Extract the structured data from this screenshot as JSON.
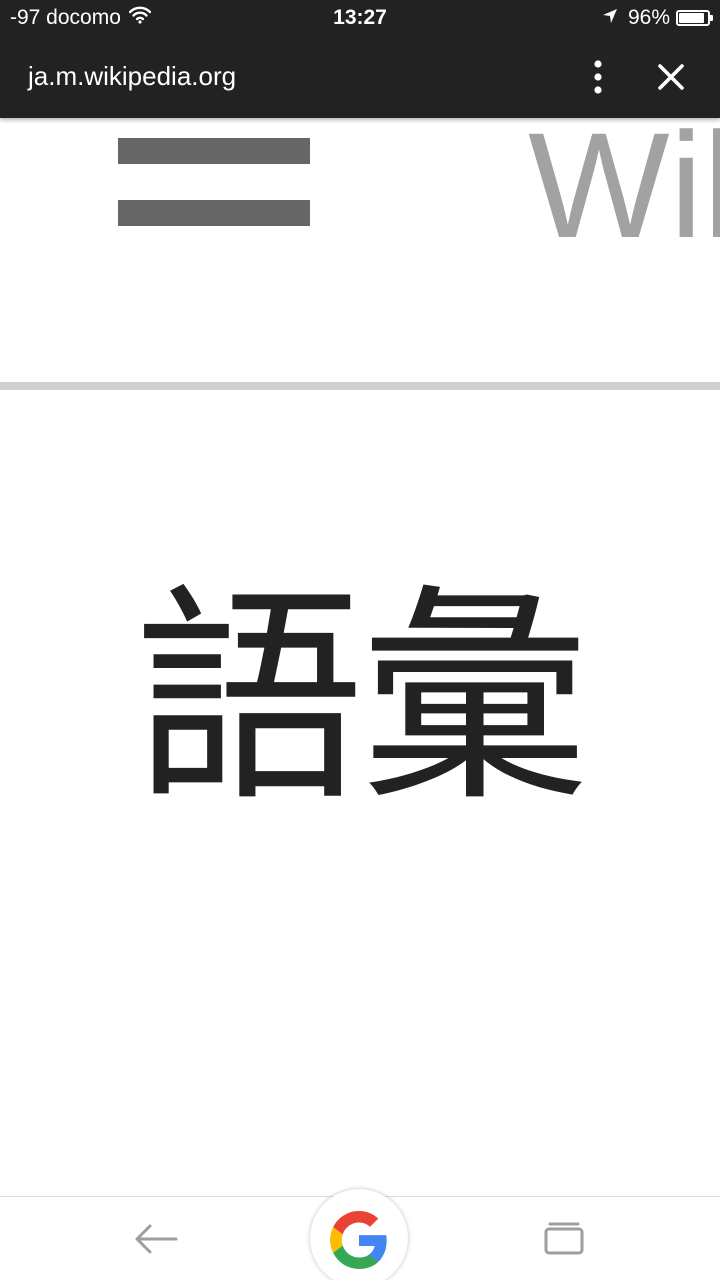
{
  "status_bar": {
    "carrier": "-97 docomo",
    "time": "13:27",
    "battery_percent_label": "96%",
    "battery_level": 0.96
  },
  "url_bar": {
    "url": "ja.m.wikipedia.org"
  },
  "header": {
    "wordmark": "Wik"
  },
  "article": {
    "title": "語彙"
  },
  "icons": {
    "wifi": "wifi-icon",
    "location": "location-arrow-icon",
    "battery": "battery-icon",
    "menu": "more-vertical-icon",
    "close": "close-icon",
    "hamburger": "hamburger-menu-icon",
    "back": "back-arrow-icon",
    "google": "google-g-icon",
    "tabs": "tabs-icon"
  },
  "colors": {
    "chrome_bg": "#222222",
    "hamburger": "#666666",
    "wordmark": "#a2a2a2",
    "divider": "#cfcfcf",
    "google_blue": "#4285F4",
    "google_red": "#EA4335",
    "google_yellow": "#FBBC05",
    "google_green": "#34A853"
  }
}
